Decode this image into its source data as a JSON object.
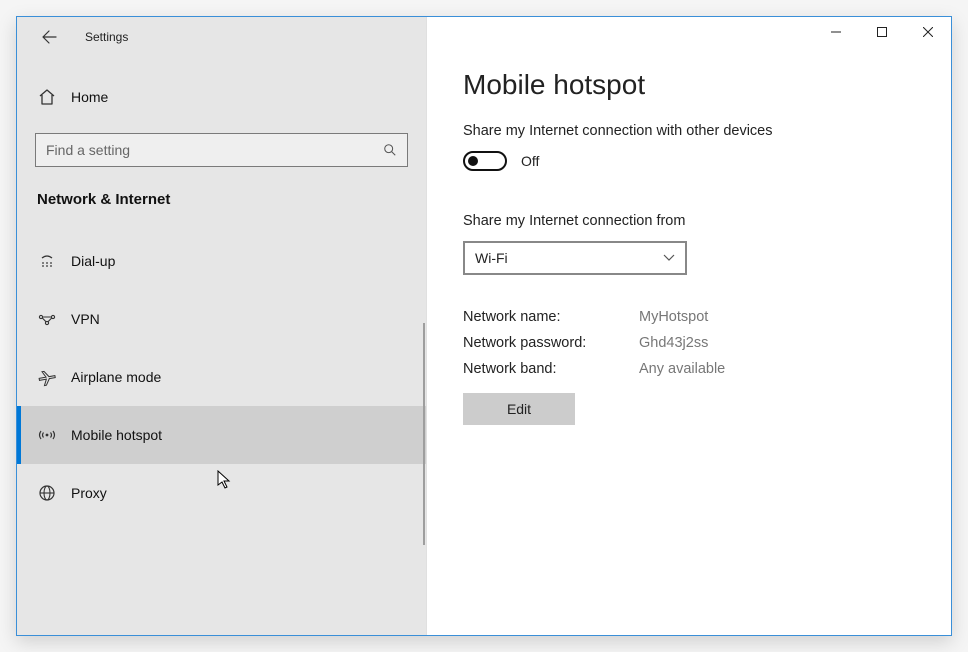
{
  "window": {
    "title": "Settings"
  },
  "sidebar": {
    "home": "Home",
    "search_placeholder": "Find a setting",
    "section": "Network & Internet",
    "items": [
      {
        "label": "Dial-up",
        "icon": "dial-up-icon",
        "selected": false
      },
      {
        "label": "VPN",
        "icon": "vpn-icon",
        "selected": false
      },
      {
        "label": "Airplane mode",
        "icon": "airplane-icon",
        "selected": false
      },
      {
        "label": "Mobile hotspot",
        "icon": "hotspot-icon",
        "selected": true
      },
      {
        "label": "Proxy",
        "icon": "proxy-icon",
        "selected": false
      }
    ]
  },
  "main": {
    "title": "Mobile hotspot",
    "share_heading": "Share my Internet connection with other devices",
    "toggle_state": "Off",
    "share_from_heading": "Share my Internet connection from",
    "share_from_value": "Wi-Fi",
    "fields": {
      "name_label": "Network name:",
      "name_value": "MyHotspot",
      "password_label": "Network password:",
      "password_value": "Ghd43j2ss",
      "band_label": "Network band:",
      "band_value": "Any available"
    },
    "edit_button": "Edit"
  }
}
